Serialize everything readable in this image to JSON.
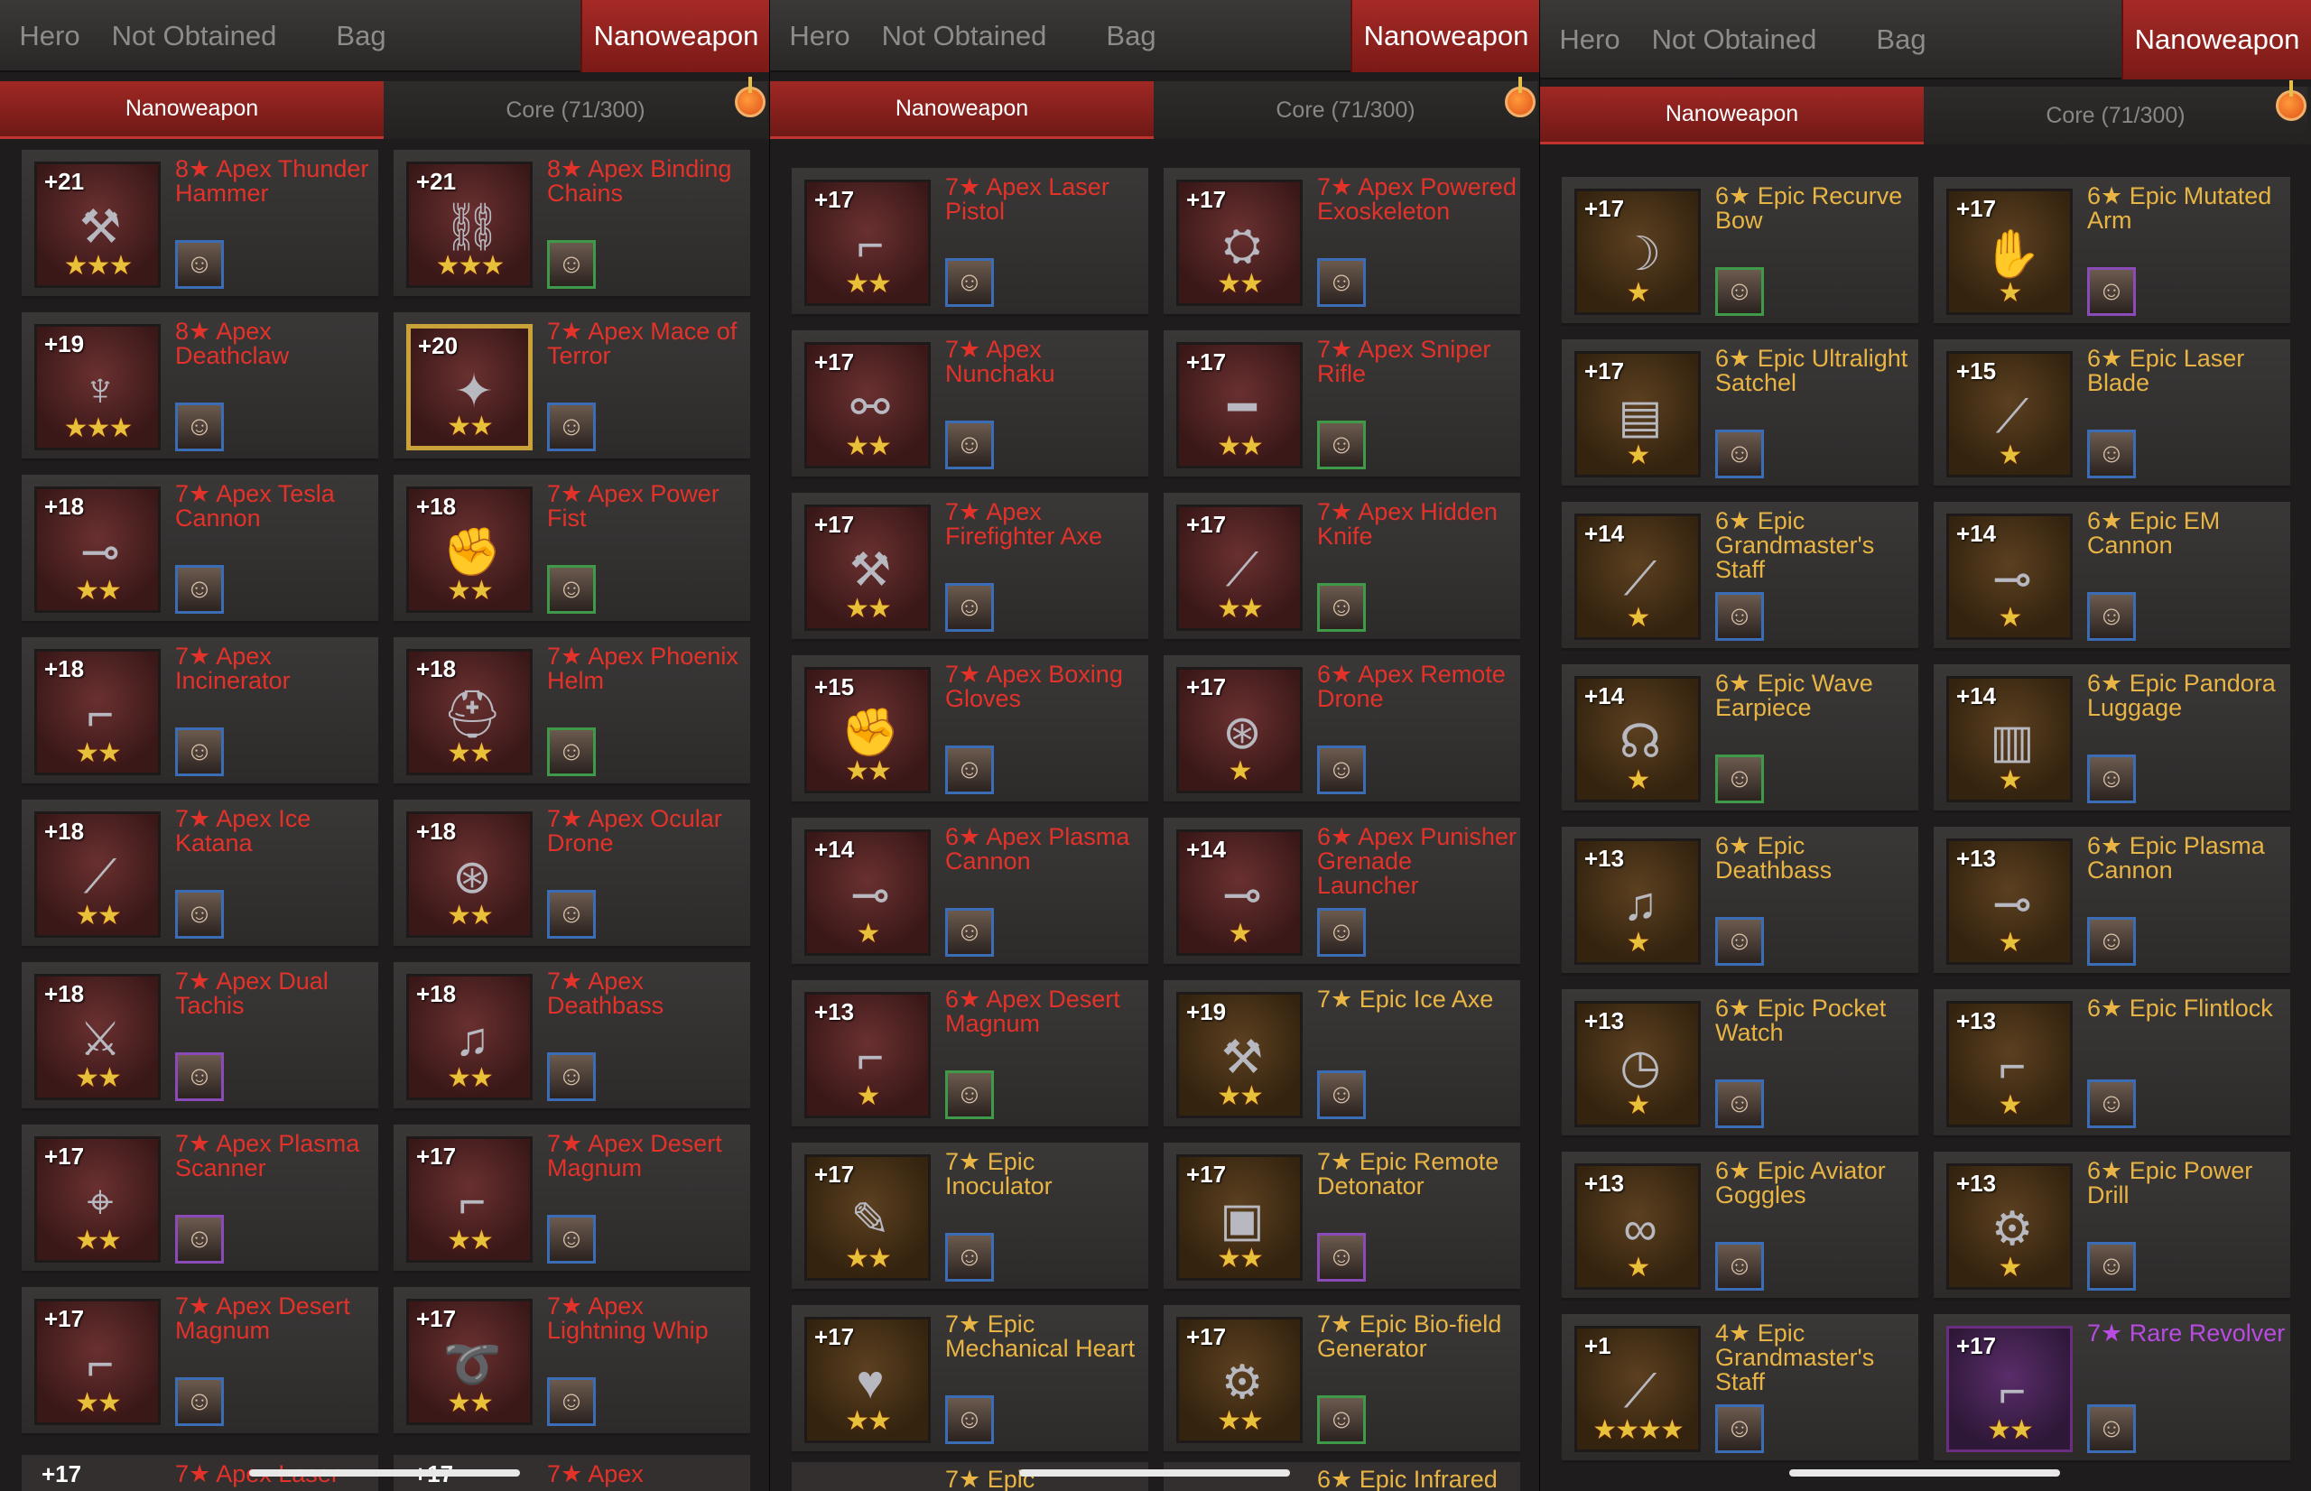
{
  "panels": [
    {
      "tabs": {
        "hero": "Hero",
        "not_obtained": "Not Obtained",
        "bag": "Bag",
        "nanoweapon": "Nanoweapon"
      },
      "subtabs": {
        "nanoweapon": "Nanoweapon",
        "core": "Core (71/300)"
      },
      "items": [
        {
          "level": "+21",
          "name": "8★ Apex Thunder Hammer",
          "stars": "★★★",
          "icon": "hammer-icon",
          "rarity": "legend",
          "avatar": "blue"
        },
        {
          "level": "+21",
          "name": "8★ Apex Binding Chains",
          "stars": "★★★",
          "icon": "chains-icon",
          "rarity": "legend",
          "avatar": "green"
        },
        {
          "level": "+19",
          "name": "8★ Apex Deathclaw",
          "stars": "★★★",
          "icon": "claw-icon",
          "rarity": "legend",
          "avatar": "blue"
        },
        {
          "level": "+20",
          "name": "7★ Apex Mace of Terror",
          "stars": "★★",
          "icon": "mace-icon",
          "rarity": "gold",
          "avatar": "blue"
        },
        {
          "level": "+18",
          "name": "7★ Apex Tesla Cannon",
          "stars": "★★",
          "icon": "cannon-icon",
          "rarity": "legend",
          "avatar": "blue"
        },
        {
          "level": "+18",
          "name": "7★ Apex Power Fist",
          "stars": "★★",
          "icon": "fist-icon",
          "rarity": "legend",
          "avatar": "green"
        },
        {
          "level": "+18",
          "name": "7★ Apex Incinerator",
          "stars": "★★",
          "icon": "gun-icon",
          "rarity": "legend",
          "avatar": "blue"
        },
        {
          "level": "+18",
          "name": "7★ Apex Phoenix Helm",
          "stars": "★★",
          "icon": "helm-icon",
          "rarity": "legend",
          "avatar": "green"
        },
        {
          "level": "+18",
          "name": "7★ Apex Ice Katana",
          "stars": "★★",
          "icon": "katana-icon",
          "rarity": "legend",
          "avatar": "blue"
        },
        {
          "level": "+18",
          "name": "7★ Apex Ocular Drone",
          "stars": "★★",
          "icon": "drone-icon",
          "rarity": "legend",
          "avatar": "blue"
        },
        {
          "level": "+18",
          "name": "7★ Apex Dual Tachis",
          "stars": "★★",
          "icon": "blades-icon",
          "rarity": "legend",
          "avatar": "purple"
        },
        {
          "level": "+18",
          "name": "7★ Apex Deathbass",
          "stars": "★★",
          "icon": "guitar-icon",
          "rarity": "legend",
          "avatar": "blue"
        },
        {
          "level": "+17",
          "name": "7★ Apex Plasma Scanner",
          "stars": "★★",
          "icon": "scanner-icon",
          "rarity": "legend",
          "avatar": "purple"
        },
        {
          "level": "+17",
          "name": "7★ Apex Desert Magnum",
          "stars": "★★",
          "icon": "pistol-icon",
          "rarity": "legend",
          "avatar": "blue"
        },
        {
          "level": "+17",
          "name": "7★ Apex Desert Magnum",
          "stars": "★★",
          "icon": "pistol-icon",
          "rarity": "legend",
          "avatar": "blue"
        },
        {
          "level": "+17",
          "name": "7★ Apex Lightning Whip",
          "stars": "★★",
          "icon": "whip-icon",
          "rarity": "legend",
          "avatar": "blue"
        }
      ]
    },
    {
      "tabs": {
        "hero": "Hero",
        "not_obtained": "Not Obtained",
        "bag": "Bag",
        "nanoweapon": "Nanoweapon"
      },
      "subtabs": {
        "nanoweapon": "Nanoweapon",
        "core": "Core (71/300)"
      },
      "items": [
        {
          "level": "+17",
          "name": "7★ Apex Laser Pistol",
          "stars": "★★",
          "icon": "laser-pistol-icon",
          "rarity": "legend",
          "avatar": "blue"
        },
        {
          "level": "+17",
          "name": "7★ Apex Powered Exoskeleton",
          "stars": "★★",
          "icon": "exoskeleton-icon",
          "rarity": "legend",
          "avatar": "blue"
        },
        {
          "level": "+17",
          "name": "7★ Apex Nunchaku",
          "stars": "★★",
          "icon": "nunchaku-icon",
          "rarity": "legend",
          "avatar": "blue"
        },
        {
          "level": "+17",
          "name": "7★ Apex Sniper Rifle",
          "stars": "★★",
          "icon": "rifle-icon",
          "rarity": "legend",
          "avatar": "green"
        },
        {
          "level": "+17",
          "name": "7★ Apex Firefighter Axe",
          "stars": "★★",
          "icon": "axe-icon",
          "rarity": "legend",
          "avatar": "blue"
        },
        {
          "level": "+17",
          "name": "7★ Apex Hidden Knife",
          "stars": "★★",
          "icon": "knife-icon",
          "rarity": "legend",
          "avatar": "green"
        },
        {
          "level": "+15",
          "name": "7★ Apex Boxing Gloves",
          "stars": "★★",
          "icon": "gloves-icon",
          "rarity": "legend",
          "avatar": "blue"
        },
        {
          "level": "+17",
          "name": "6★ Apex Remote Drone",
          "stars": "★",
          "icon": "drone-icon",
          "rarity": "legend",
          "avatar": "blue"
        },
        {
          "level": "+14",
          "name": "6★ Apex Plasma Cannon",
          "stars": "★",
          "icon": "plasma-cannon-icon",
          "rarity": "legend",
          "avatar": "blue"
        },
        {
          "level": "+14",
          "name": "6★ Apex Punisher Grenade Launcher",
          "stars": "★",
          "icon": "launcher-icon",
          "rarity": "legend",
          "avatar": "blue"
        },
        {
          "level": "+13",
          "name": "6★ Apex Desert Magnum",
          "stars": "★",
          "icon": "pistol-icon",
          "rarity": "legend",
          "avatar": "green"
        },
        {
          "level": "+19",
          "name": "7★ Epic Ice Axe",
          "stars": "★★",
          "icon": "ice-axe-icon",
          "rarity": "epic",
          "avatar": "blue"
        },
        {
          "level": "+17",
          "name": "7★ Epic Inoculator",
          "stars": "★★",
          "icon": "syringe-icon",
          "rarity": "epic",
          "avatar": "blue"
        },
        {
          "level": "+17",
          "name": "7★ Epic Remote Detonator",
          "stars": "★★",
          "icon": "detonator-icon",
          "rarity": "epic",
          "avatar": "purple"
        },
        {
          "level": "+17",
          "name": "7★ Epic Mechanical Heart",
          "stars": "★★",
          "icon": "heart-icon",
          "rarity": "epic",
          "avatar": "blue"
        },
        {
          "level": "+17",
          "name": "7★ Epic Bio-field Generator",
          "stars": "★★",
          "icon": "generator-icon",
          "rarity": "epic",
          "avatar": "green"
        }
      ]
    },
    {
      "tabs": {
        "hero": "Hero",
        "not_obtained": "Not Obtained",
        "bag": "Bag",
        "nanoweapon": "Nanoweapon"
      },
      "subtabs": {
        "nanoweapon": "Nanoweapon",
        "core": "Core (71/300)"
      },
      "items": [
        {
          "level": "+17",
          "name": "6★ Epic Recurve Bow",
          "stars": "★",
          "icon": "bow-icon",
          "rarity": "epic",
          "avatar": "green"
        },
        {
          "level": "+17",
          "name": "6★ Epic Mutated Arm",
          "stars": "★",
          "icon": "arm-icon",
          "rarity": "epic",
          "avatar": "purple"
        },
        {
          "level": "+17",
          "name": "6★ Epic Ultralight Satchel",
          "stars": "★",
          "icon": "satchel-icon",
          "rarity": "epic",
          "avatar": "blue"
        },
        {
          "level": "+15",
          "name": "6★ Epic Laser Blade",
          "stars": "★",
          "icon": "blade-icon",
          "rarity": "epic",
          "avatar": "blue"
        },
        {
          "level": "+14",
          "name": "6★ Epic Grandmaster's Staff",
          "stars": "★",
          "icon": "staff-icon",
          "rarity": "epic",
          "avatar": "blue"
        },
        {
          "level": "+14",
          "name": "6★ Epic EM Cannon",
          "stars": "★",
          "icon": "cannon-icon",
          "rarity": "epic",
          "avatar": "blue"
        },
        {
          "level": "+14",
          "name": "6★ Epic Wave Earpiece",
          "stars": "★",
          "icon": "headset-icon",
          "rarity": "epic",
          "avatar": "green"
        },
        {
          "level": "+14",
          "name": "6★ Epic Pandora Luggage",
          "stars": "★",
          "icon": "luggage-icon",
          "rarity": "epic",
          "avatar": "blue"
        },
        {
          "level": "+13",
          "name": "6★ Epic Deathbass",
          "stars": "★",
          "icon": "guitar-icon",
          "rarity": "epic",
          "avatar": "blue"
        },
        {
          "level": "+13",
          "name": "6★ Epic Plasma Cannon",
          "stars": "★",
          "icon": "plasma-cannon-icon",
          "rarity": "epic",
          "avatar": "blue"
        },
        {
          "level": "+13",
          "name": "6★ Epic Pocket Watch",
          "stars": "★",
          "icon": "watch-icon",
          "rarity": "epic",
          "avatar": "blue"
        },
        {
          "level": "+13",
          "name": "6★ Epic Flintlock",
          "stars": "★",
          "icon": "flintlock-icon",
          "rarity": "epic",
          "avatar": "blue"
        },
        {
          "level": "+13",
          "name": "6★ Epic Aviator Goggles",
          "stars": "★",
          "icon": "goggles-icon",
          "rarity": "epic",
          "avatar": "blue"
        },
        {
          "level": "+13",
          "name": "6★ Epic Power Drill",
          "stars": "★",
          "icon": "drill-icon",
          "rarity": "epic",
          "avatar": "blue"
        },
        {
          "level": "+1",
          "name": "4★ Epic Grandmaster's Staff",
          "stars": "★★★★",
          "icon": "staff-icon",
          "rarity": "epic",
          "avatar": "blue"
        },
        {
          "level": "+17",
          "name": "7★ Rare Revolver",
          "stars": "★★",
          "icon": "revolver-icon",
          "rarity": "rare",
          "avatar": "blue"
        }
      ]
    }
  ],
  "partial_bottom": {
    "p1": [
      "+17",
      "7★ Apex Laser",
      "+17",
      "7★ Apex"
    ],
    "p2": [
      "7★ Epic",
      "6★ Epic Infrared"
    ]
  },
  "colors": {
    "apex_name": "#e2322a",
    "epic_name": "#e8b444",
    "rare_name": "#b84be0",
    "active_tab": "#a62a26"
  }
}
